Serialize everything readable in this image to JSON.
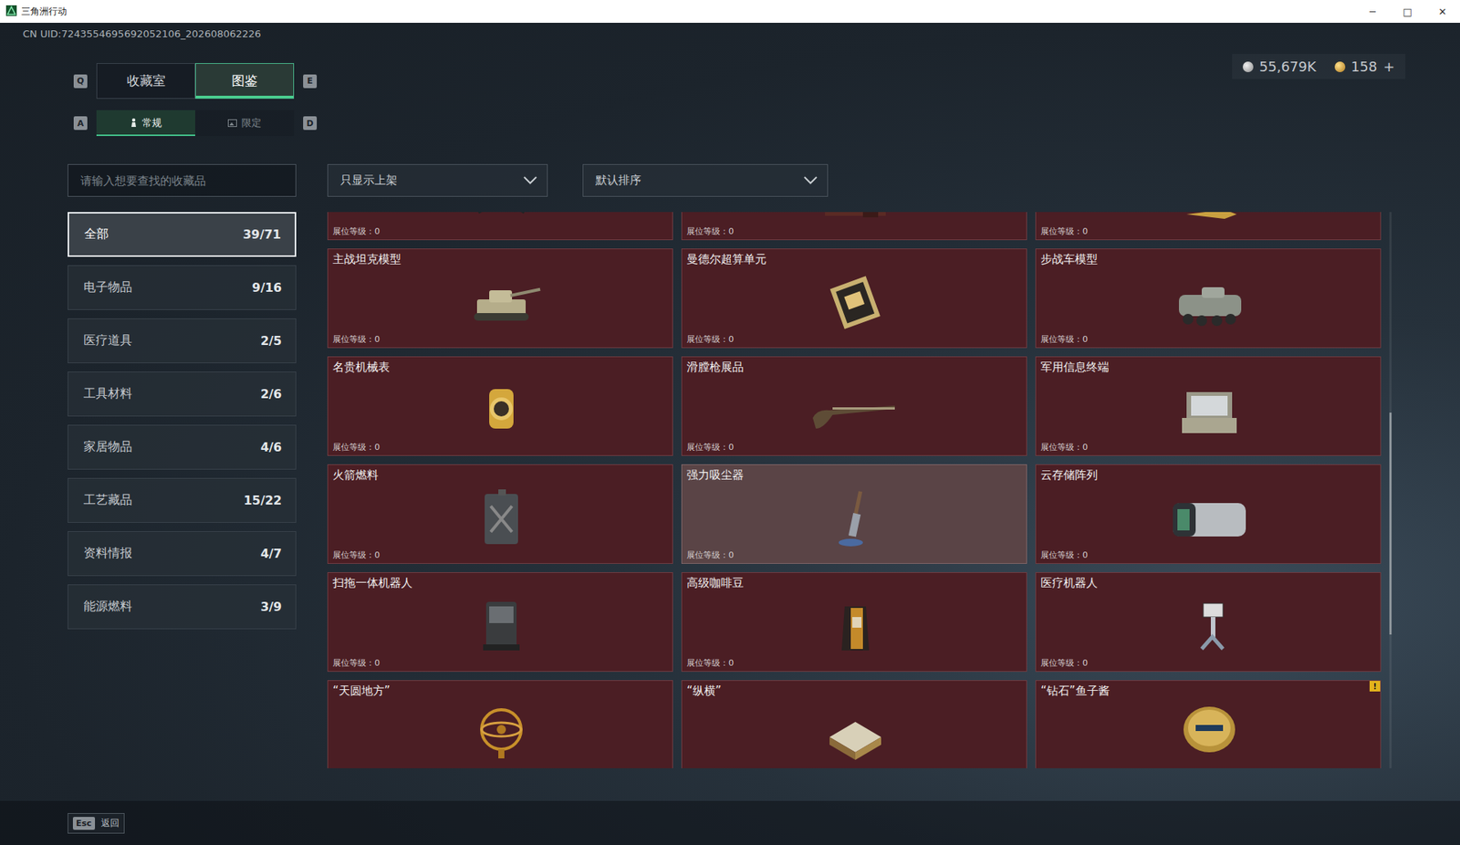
{
  "window": {
    "title": "三角洲行动",
    "controls": [
      "─",
      "□",
      "✕"
    ]
  },
  "uid": "CN UID:7243554695692052106_202608062226",
  "currency": [
    {
      "amount": "55,679K",
      "kind": "silver"
    },
    {
      "amount": "158",
      "kind": "gold",
      "add": "+"
    }
  ],
  "tabs": {
    "prev_key": "Q",
    "next_key": "E",
    "items": [
      {
        "label": "收藏室",
        "selected": false
      },
      {
        "label": "图鉴",
        "selected": true
      }
    ]
  },
  "subtabs": {
    "prev_key": "A",
    "next_key": "D",
    "items": [
      {
        "label": "常规",
        "selected": true
      },
      {
        "label": "限定",
        "selected": false
      }
    ]
  },
  "search": {
    "placeholder": "请输入想要查找的收藏品"
  },
  "filters": [
    {
      "label": "只显示上架"
    },
    {
      "label": "默认排序"
    }
  ],
  "sidebar": {
    "items": [
      {
        "label": "全部",
        "count": "39/71",
        "selected": true
      },
      {
        "label": "电子物品",
        "count": "9/16",
        "selected": false
      },
      {
        "label": "医疗道具",
        "count": "2/5",
        "selected": false
      },
      {
        "label": "工具材料",
        "count": "2/6",
        "selected": false
      },
      {
        "label": "家居物品",
        "count": "4/6",
        "selected": false
      },
      {
        "label": "工艺藏品",
        "count": "15/22",
        "selected": false
      },
      {
        "label": "资料情报",
        "count": "4/7",
        "selected": false
      },
      {
        "label": "能源燃料",
        "count": "3/9",
        "selected": false
      }
    ]
  },
  "grid": {
    "cards": [
      {
        "booth": "展位等级：0",
        "highlighted": false
      },
      {
        "booth": "展位等级：0",
        "highlighted": false
      },
      {
        "booth": "展位等级：0",
        "highlighted": false
      },
      {
        "name": "主战坦克模型",
        "booth": "展位等级：0",
        "highlighted": false
      },
      {
        "name": "曼德尔超算单元",
        "booth": "展位等级：0",
        "highlighted": false
      },
      {
        "name": "步战车模型",
        "booth": "展位等级：0",
        "highlighted": false
      },
      {
        "name": "名贵机械表",
        "booth": "展位等级：0",
        "highlighted": false
      },
      {
        "name": "滑膛枪展品",
        "booth": "展位等级：0",
        "highlighted": false
      },
      {
        "name": "军用信息终端",
        "booth": "展位等级：0",
        "highlighted": false
      },
      {
        "name": "火箭燃料",
        "booth": "展位等级：0",
        "highlighted": false
      },
      {
        "name": "强力吸尘器",
        "booth": "展位等级：0",
        "highlighted": true
      },
      {
        "name": "云存储阵列",
        "booth": "展位等级：0",
        "highlighted": false
      },
      {
        "name": "扫拖一体机器人",
        "booth": "展位等级：0",
        "highlighted": false
      },
      {
        "name": "高级咖啡豆",
        "booth": "展位等级：0",
        "highlighted": false
      },
      {
        "name": "医疗机器人",
        "booth": "展位等级：0",
        "highlighted": false
      },
      {
        "name": "“天圆地方”",
        "highlighted": false
      },
      {
        "name": "“纵横”",
        "highlighted": false
      },
      {
        "name": "“钻石”鱼子酱",
        "highlighted": false,
        "badge": "!"
      }
    ]
  },
  "scrollbar": {
    "offset": 0.36,
    "level": 0.4
  },
  "footer": {
    "key": "Esc",
    "label": "返回"
  }
}
